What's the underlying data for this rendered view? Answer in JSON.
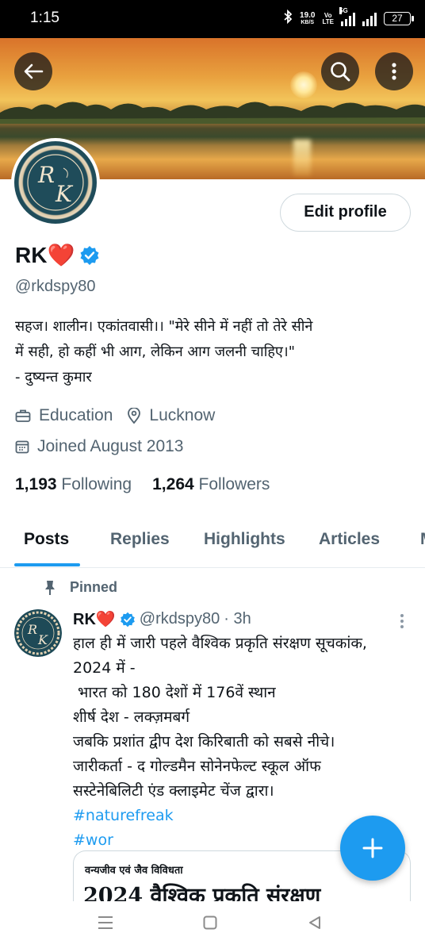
{
  "status_bar": {
    "time": "1:15",
    "speed_value": "19.0",
    "speed_unit": "KB/S",
    "volte_line1": "Vo",
    "volte_line2": "LTE",
    "network": "5G",
    "battery": "27"
  },
  "header": {
    "back_icon": "arrow-left-icon",
    "search_icon": "search-icon",
    "more_icon": "more-vertical-icon"
  },
  "profile": {
    "avatar_monogram_top": "R",
    "avatar_monogram_bottom": "K",
    "edit_profile_label": "Edit profile",
    "display_name": "RK❤️",
    "verified_icon": "verified-badge-icon",
    "handle": "@rkdspy80",
    "bio_lines": [
      "सहज। शालीन। एकांतवासी।। \"मेरे सीने में नहीं तो तेरे सीने",
      "में सही, हो कहीं भी आग, लेकिन आग जलनी चाहिए।\"",
      "- दुष्यन्त कुमार"
    ],
    "category": "Education",
    "location": "Lucknow",
    "joined": "Joined August 2013",
    "following_count": "1,193",
    "following_label": "Following",
    "followers_count": "1,264",
    "followers_label": "Followers"
  },
  "tabs": [
    {
      "label": "Posts",
      "active": true
    },
    {
      "label": "Replies",
      "active": false
    },
    {
      "label": "Highlights",
      "active": false
    },
    {
      "label": "Articles",
      "active": false
    }
  ],
  "pinned_tweet": {
    "pinned_label": "Pinned",
    "author_name": "RK❤️",
    "author_handle": "@rkdspy80",
    "time": "· 3h",
    "lines": [
      "हाल ही में जारी पहले वैश्विक प्रकृति संरक्षण सूचकांक,",
      "2024 में -",
      " भारत को 180 देशों में 176वें स्थान",
      "शीर्ष देश - लक्ज़मबर्ग",
      "जबकि प्रशांत द्वीप देश किरिबाती को सबसे नीचे।",
      "जारीकर्ता - द गोल्डमैन सोनेनफेल्ट स्कूल ऑफ",
      "सस्टेनेबिलिटी एंड क्लाइमेट चेंज द्वारा।"
    ],
    "hashtags": [
      "#naturefreak",
      "#wor"
    ],
    "card_small": "वन्यजीव एवं जैव विविधता",
    "card_big": "2024 वैश्विक प्रकृति संरक्षण"
  },
  "fab": {
    "icon": "plus-icon"
  },
  "colors": {
    "accent": "#1d9bf0",
    "text": "#0f1419",
    "muted": "#536471"
  }
}
